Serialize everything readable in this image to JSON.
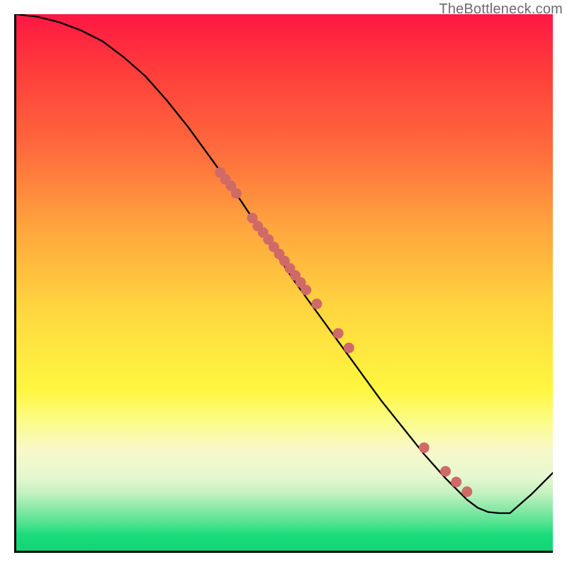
{
  "watermark": "TheBottleneck.com",
  "chart_data": {
    "type": "line",
    "title": "",
    "xlabel": "",
    "ylabel": "",
    "xlim": [
      0,
      100
    ],
    "ylim": [
      0,
      100
    ],
    "series": [
      {
        "name": "curve",
        "x": [
          0,
          4,
          8,
          12,
          16,
          20,
          24,
          28,
          32,
          36,
          40,
          44,
          48,
          52,
          56,
          60,
          64,
          68,
          72,
          76,
          80,
          84,
          86,
          88,
          90,
          92,
          96,
          100
        ],
        "y": [
          100,
          99.5,
          98.5,
          97,
          95,
          92,
          88.5,
          84,
          79,
          73.5,
          68,
          62,
          56,
          50,
          44.5,
          39,
          33.5,
          28,
          23,
          18,
          13.5,
          9.5,
          8,
          7.2,
          7,
          7,
          10.5,
          14.5
        ]
      }
    ],
    "markers": {
      "name": "highlight-points",
      "x": [
        38,
        39,
        40,
        41,
        44,
        45,
        46,
        47,
        48,
        49,
        50,
        51,
        52,
        53,
        54,
        56,
        60,
        62,
        76,
        80,
        82,
        84
      ],
      "y": [
        70.5,
        69.2,
        68,
        66.6,
        62,
        60.5,
        59.3,
        58,
        56.6,
        55.3,
        54,
        52.6,
        51.3,
        50,
        48.6,
        46,
        40.5,
        37.8,
        19.2,
        14.8,
        12.8,
        11
      ]
    },
    "background_gradient": {
      "orientation": "vertical",
      "stops": [
        {
          "pos": 0.0,
          "color": "#ff1744"
        },
        {
          "pos": 0.25,
          "color": "#ff6a3d"
        },
        {
          "pos": 0.55,
          "color": "#ffd63f"
        },
        {
          "pos": 0.78,
          "color": "#fcfc8a"
        },
        {
          "pos": 0.9,
          "color": "#8de9a8"
        },
        {
          "pos": 1.0,
          "color": "#14d474"
        }
      ]
    }
  }
}
